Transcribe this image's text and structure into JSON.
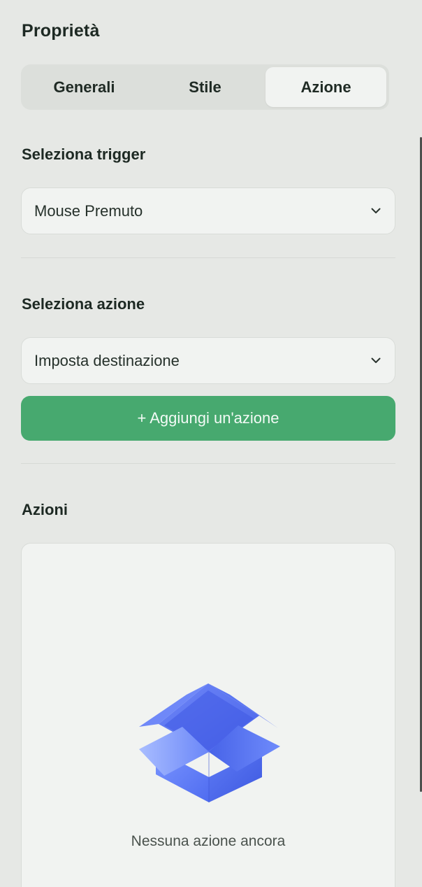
{
  "panel": {
    "title": "Proprietà"
  },
  "tabs": [
    {
      "label": "Generali",
      "active": false
    },
    {
      "label": "Stile",
      "active": false
    },
    {
      "label": "Azione",
      "active": true
    }
  ],
  "trigger": {
    "label": "Seleziona trigger",
    "value": "Mouse Premuto",
    "icon": "chevron-down-icon"
  },
  "action": {
    "label": "Seleziona azione",
    "value": "Imposta destinazione",
    "icon": "chevron-down-icon",
    "add_button_label": "+ Aggiungi un'azione"
  },
  "actions_list": {
    "label": "Azioni",
    "empty_icon": "open-box-icon",
    "empty_text": "Nessuna azione ancora"
  },
  "colors": {
    "accent": "#47a96f",
    "background": "#e6e8e5",
    "card": "#f1f3f1",
    "illustration": "#5a7cf2"
  }
}
